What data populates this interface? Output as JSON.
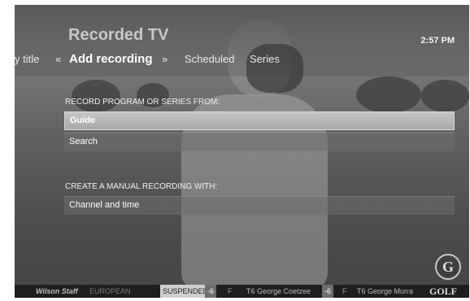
{
  "header": {
    "section_title": "Recorded TV",
    "clock": "2:57 PM"
  },
  "tabs": {
    "previous": "y title",
    "left_arrow": "«",
    "active": "Add recording",
    "right_arrow": "»",
    "next1": "Scheduled",
    "next2": "Series"
  },
  "menu": {
    "group1_label": "RECORD PROGRAM OR SERIES FROM:",
    "group1_items": [
      "Guide",
      "Search"
    ],
    "group2_label": "CREATE A MANUAL RECORDING WITH:",
    "group2_items": [
      "Channel and time"
    ],
    "selected_item": "Guide"
  },
  "ticker": {
    "sponsor": "Wilson Staff",
    "tour": "EUROPEAN",
    "status": "SUSPENDED",
    "score1": "-6",
    "flag1": "F",
    "name1": "T6 George Coetzee",
    "score2": "-6",
    "flag2": "F",
    "name2": "T6 George Murra",
    "network": "GOLF"
  },
  "logo_bug": "G"
}
